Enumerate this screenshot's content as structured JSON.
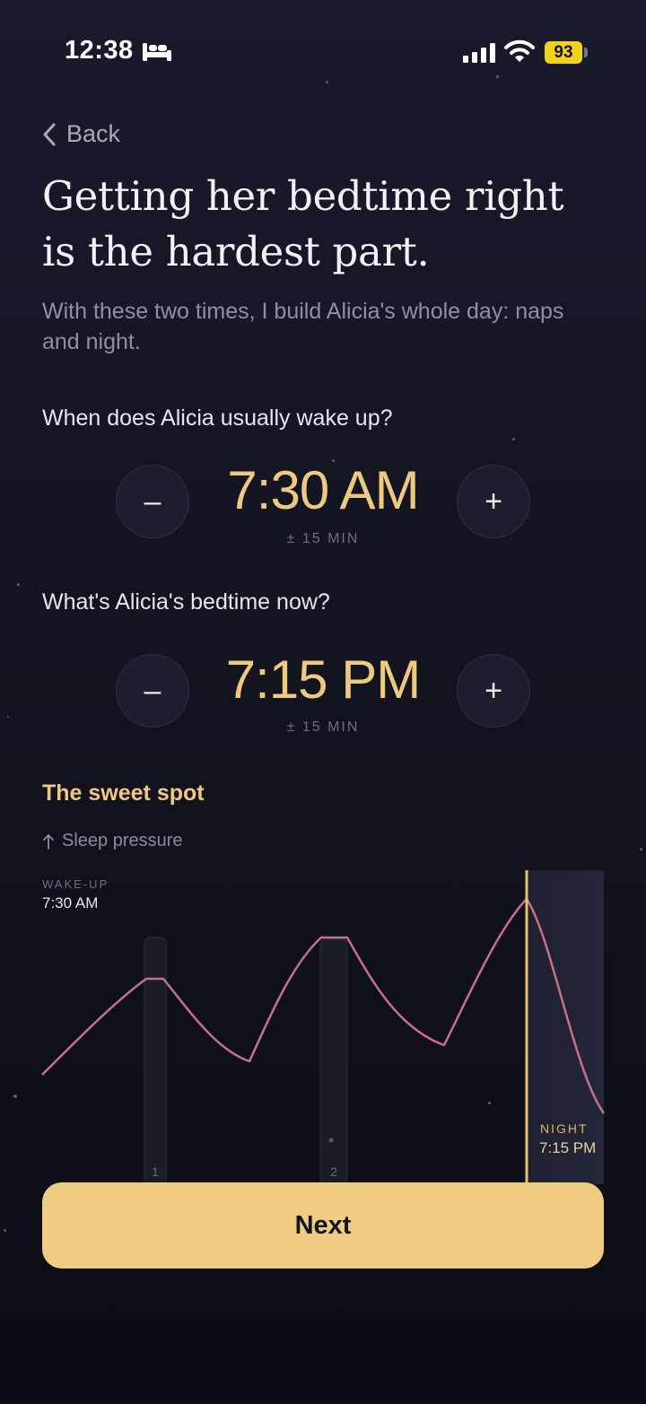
{
  "status_bar": {
    "time": "12:38",
    "battery": "93"
  },
  "back_label": "Back",
  "headline_line1": "Getting her bedtime right",
  "headline_line2": "is the hardest part.",
  "subtitle": "With these two times, I build Alicia's whole day: naps and night.",
  "wake": {
    "question": "When does Alicia usually wake up?",
    "value": "7:30 AM",
    "tolerance": "± 15 MIN",
    "minus": "–",
    "plus": "+"
  },
  "bedtime": {
    "question": "What's Alicia's bedtime now?",
    "value": "7:15 PM",
    "tolerance": "± 15 MIN",
    "minus": "–",
    "plus": "+"
  },
  "sweet_spot": {
    "title": "The sweet spot",
    "pressure_label": "Sleep pressure",
    "wake_caption": "WAKE-UP",
    "wake_time": "7:30 AM",
    "night_caption": "NIGHT",
    "night_time": "7:15 PM",
    "nap_labels": [
      "1",
      "2"
    ]
  },
  "colors": {
    "accent": "#f0c981",
    "curve": "#c8708a",
    "button": "#f0cc83"
  },
  "next_label": "Next"
}
